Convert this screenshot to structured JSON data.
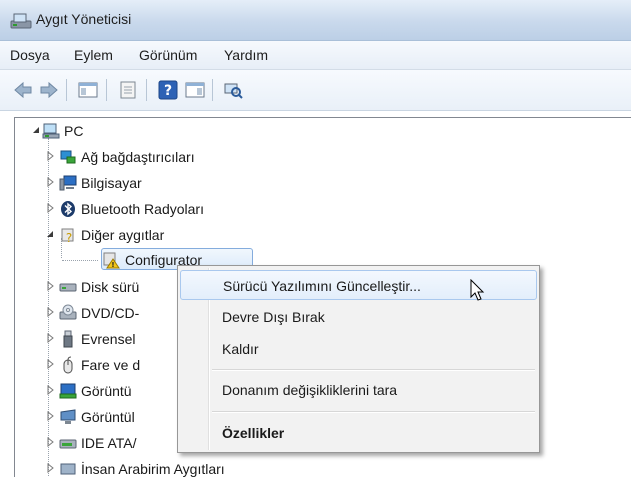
{
  "window": {
    "title": "Aygıt Yöneticisi"
  },
  "menu": {
    "items": [
      "Dosya",
      "Eylem",
      "Görünüm",
      "Yardım"
    ]
  },
  "tree": {
    "root": "PC",
    "nodes": [
      {
        "label": "Ağ bağdaştırıcıları",
        "icon": "network-adapter-icon",
        "expanded": false
      },
      {
        "label": "Bilgisayar",
        "icon": "computer-icon",
        "expanded": false
      },
      {
        "label": "Bluetooth Radyoları",
        "icon": "bluetooth-icon",
        "expanded": false
      },
      {
        "label": "Diğer aygıtlar",
        "icon": "other-devices-icon",
        "expanded": true
      },
      {
        "label": "Configurator",
        "icon": "warning-device-icon",
        "child": true
      },
      {
        "label": "Disk sürü",
        "icon": "disk-drive-icon",
        "expanded": false
      },
      {
        "label": "DVD/CD-",
        "icon": "dvd-drive-icon",
        "expanded": false
      },
      {
        "label": "Evrensel",
        "icon": "usb-icon",
        "expanded": false
      },
      {
        "label": "Fare ve d",
        "icon": "mouse-icon",
        "expanded": false
      },
      {
        "label": "Görüntü",
        "icon": "display-adapter-icon",
        "expanded": false
      },
      {
        "label": "Görüntül",
        "icon": "monitor-icon",
        "expanded": false
      },
      {
        "label": "IDE ATA/",
        "icon": "ide-controller-icon",
        "expanded": false
      },
      {
        "label": "İnsan Arabirim Aygıtları",
        "icon": "hid-icon",
        "expanded": false
      }
    ]
  },
  "context_menu": {
    "items": [
      {
        "label": "Sürücü Yazılımını Güncelleştir...",
        "hovered": true
      },
      {
        "label": "Devre Dışı Bırak"
      },
      {
        "label": "Kaldır"
      },
      {
        "label": "Donanım değişikliklerini tara"
      },
      {
        "label": "Özellikler",
        "bold": true
      }
    ]
  }
}
